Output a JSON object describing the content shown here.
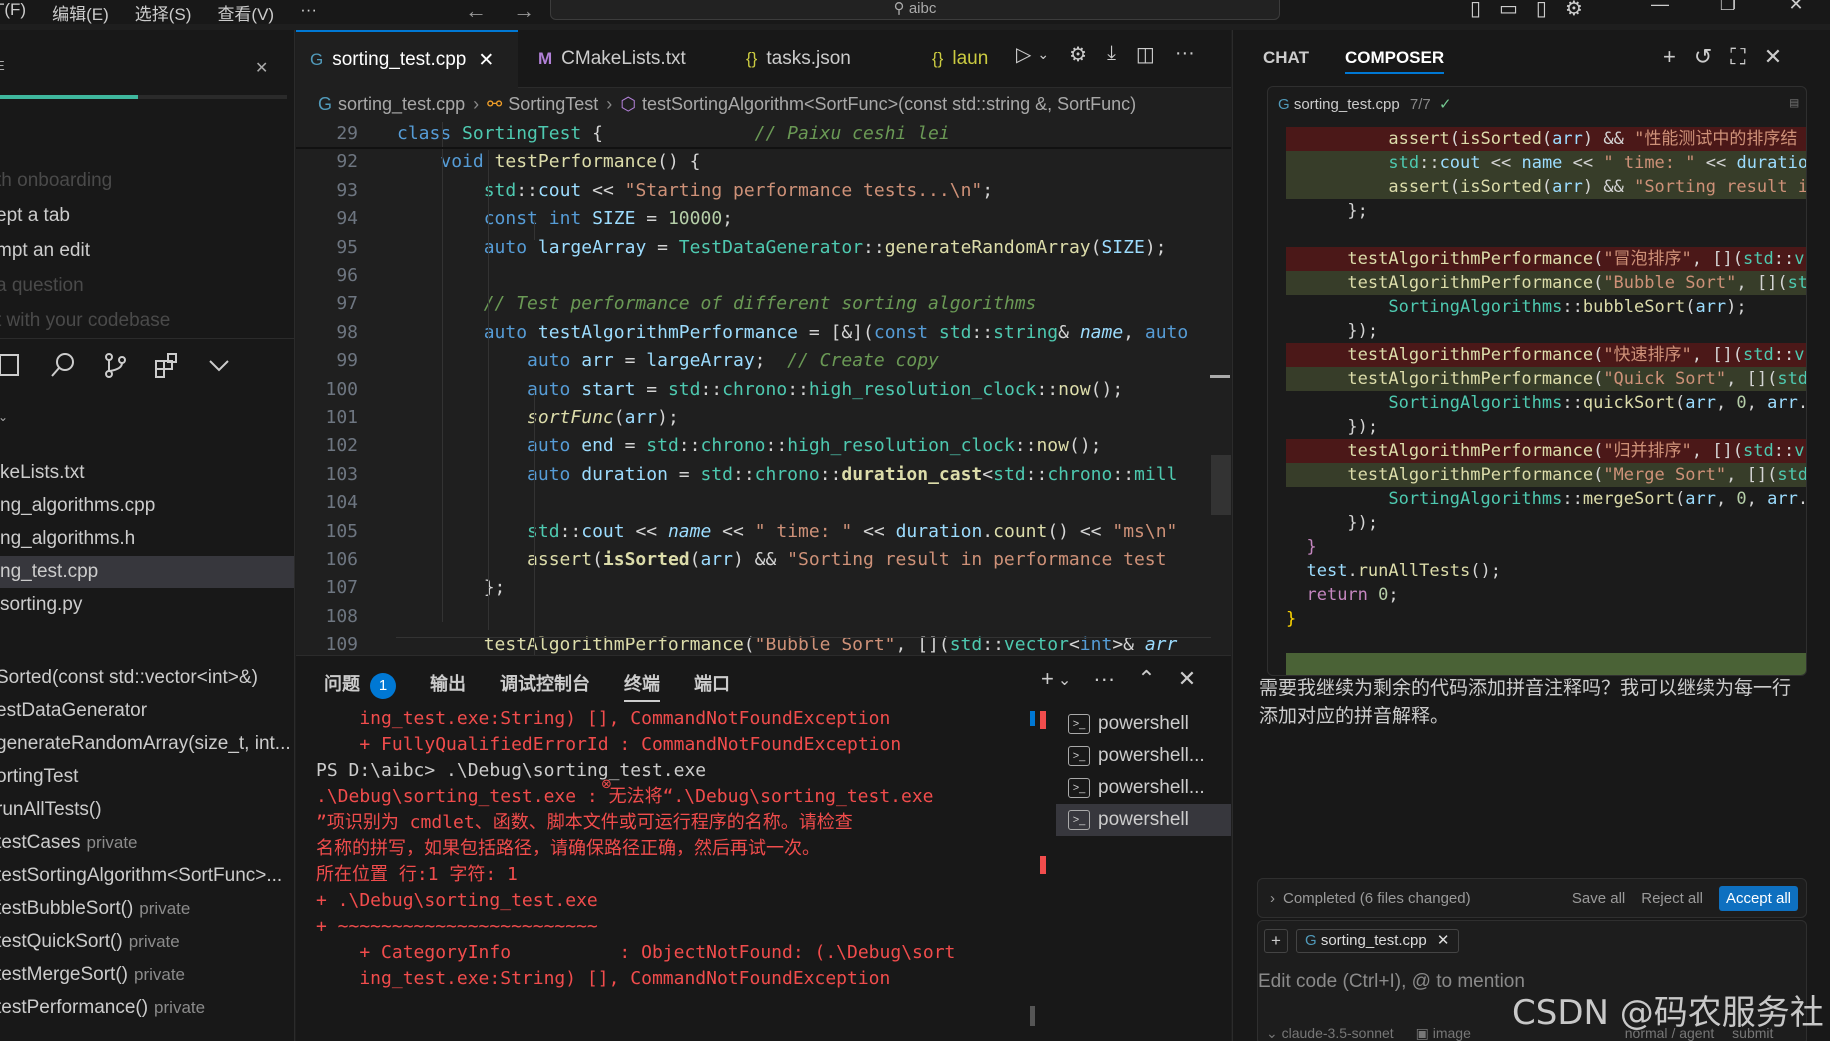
{
  "menu": [
    "T(F)",
    "编辑(E)",
    "选择(S)",
    "查看(V)",
    "···"
  ],
  "command_center": "aibc",
  "sidebar": {
    "onboarding": [
      {
        "label": "th onboarding",
        "dim": true
      },
      {
        "label": "ept a tab",
        "dim": false
      },
      {
        "label": "mpt an edit",
        "dim": false
      },
      {
        "label": "a question",
        "dim": true
      },
      {
        "label": "t with your codebase",
        "dim": true
      }
    ],
    "onboarding_progress": 0.48,
    "files": [
      "keLists.txt",
      "ng_algorithms.cpp",
      "ng_algorithms.h",
      "ng_test.cpp",
      "sorting.py"
    ],
    "selected_file": "ng_test.cpp",
    "outline": [
      {
        "name": "Sorted(const std::vector<int>&)",
        "vis": ""
      },
      {
        "name": "estDataGenerator",
        "vis": ""
      },
      {
        "name": "generateRandomArray(size_t, int...",
        "vis": ""
      },
      {
        "name": "ortingTest",
        "vis": ""
      },
      {
        "name": "runAllTests()",
        "vis": ""
      },
      {
        "name": "testCases",
        "vis": "private"
      },
      {
        "name": "testSortingAlgorithm<SortFunc>...",
        "vis": ""
      },
      {
        "name": "testBubbleSort()",
        "vis": "private"
      },
      {
        "name": "testQuickSort()",
        "vis": "private"
      },
      {
        "name": "testMergeSort()",
        "vis": "private"
      },
      {
        "name": "testPerformance()",
        "vis": "private"
      }
    ]
  },
  "tabs": [
    {
      "label": "sorting_test.cpp",
      "active": true,
      "icon": "C++"
    },
    {
      "label": "CMakeLists.txt",
      "active": false,
      "icon": "M"
    },
    {
      "label": "tasks.json",
      "active": false,
      "icon": "{}"
    },
    {
      "label": "laun",
      "active": false,
      "icon": "{}"
    }
  ],
  "breadcrumb": [
    "sorting_test.cpp",
    "SortingTest",
    "testSortingAlgorithm<SortFunc>(const std::string &, SortFunc)"
  ],
  "code_lines": [
    {
      "n": "29",
      "html": "<span class='k'>class</span> <span class='t'>SortingTest</span> {              <span class='c'>// Paixu ceshi lei</span>"
    },
    {
      "n": "92",
      "html": "    <span class='k'>void</span> <span class='f'>testPerformance</span>() {"
    },
    {
      "n": "93",
      "html": "        <span class='t'>std</span>::<span class='v'>cout</span> &lt;&lt; <span class='s'>\"Starting performance tests...\\n\"</span>;"
    },
    {
      "n": "94",
      "html": "        <span class='k'>const</span> <span class='k'>int</span> <span class='v'>SIZE</span> = <span class='n'>10000</span>;"
    },
    {
      "n": "95",
      "html": "        <span class='k'>auto</span> <span class='v'>largeArray</span> = <span class='t'>TestDataGenerator</span>::<span class='f'>generateRandomArray</span>(<span class='v'>SIZE</span>);"
    },
    {
      "n": "96",
      "html": ""
    },
    {
      "n": "97",
      "html": "        <span class='c'>// Test performance of different sorting algorithms</span>"
    },
    {
      "n": "98",
      "html": "        <span class='k'>auto</span> <span class='v'>testAlgorithmPerformance</span> = [&amp;](<span class='k'>const</span> <span class='t'>std</span>::<span class='t'>string</span>&amp; <span class='v'><i>name</i></span>, <span class='k'>auto</span>"
    },
    {
      "n": "99",
      "html": "            <span class='k'>auto</span> <span class='v'>arr</span> = <span class='v'>largeArray</span>;  <span class='c'>// Create copy</span>"
    },
    {
      "n": "100",
      "html": "            <span class='k'>auto</span> <span class='v'>start</span> = <span class='t'>std</span>::<span class='t'>chrono</span>::<span class='t'>high_resolution_clock</span>::<span class='f'>now</span>();"
    },
    {
      "n": "101",
      "html": "            <span class='f'><i>sortFunc</i></span>(<span class='v'>arr</span>);"
    },
    {
      "n": "102",
      "html": "            <span class='k'>auto</span> <span class='v'>end</span> = <span class='t'>std</span>::<span class='t'>chrono</span>::<span class='t'>high_resolution_clock</span>::<span class='f'>now</span>();"
    },
    {
      "n": "103",
      "html": "            <span class='k'>auto</span> <span class='v'>duration</span> = <span class='t'>std</span>::<span class='t'>chrono</span>::<b class='f'>duration_cast</b>&lt;<span class='t'>std</span>::<span class='t'>chrono</span>::<span class='t'>mill</span>"
    },
    {
      "n": "104",
      "html": ""
    },
    {
      "n": "105",
      "html": "            <span class='t'>std</span>::<span class='v'>cout</span> &lt;&lt; <span class='v'><i>name</i></span> &lt;&lt; <span class='s'>\" time: \"</span> &lt;&lt; <span class='v'>duration</span>.<span class='f'>count</span>() &lt;&lt; <span class='s'>\"ms\\n\"</span>"
    },
    {
      "n": "106",
      "html": "            <span class='f'>assert</span>(<b class='f'>isSorted</b>(<span class='v'>arr</span>) &amp;&amp; <span class='s'>\"Sorting result in performance test </span>"
    },
    {
      "n": "107",
      "html": "        };"
    },
    {
      "n": "108",
      "html": ""
    },
    {
      "n": "109",
      "html": "        <span class='f'>testAlgorithmPerformance</span>(<span class='s'>\"Bubble Sort\"</span>, [](<span class='t'>std</span>::<span class='t'>vector</span>&lt;<span class='k'>int</span>&gt;&amp; <span class='v'><i>arr</i></span>"
    }
  ],
  "panel": {
    "tabs": [
      "问题",
      "输出",
      "调试控制台",
      "终端",
      "端口"
    ],
    "active_tab": "终端",
    "problems_count": "1",
    "terminal_lines": [
      {
        "text": "    ing_test.exe:String) [], CommandNotFoundException",
        "white": false
      },
      {
        "text": "    + FullyQualifiedErrorId : CommandNotFoundException",
        "white": false
      },
      {
        "text": "",
        "white": false
      },
      {
        "text": "PS D:\\aibc> .\\Debug\\sorting_test.exe",
        "white": true
      },
      {
        "text": ".\\Debug\\sorting_test.exe : 无法将“.\\Debug\\sorting_test.exe",
        "white": false
      },
      {
        "text": "”项识别为 cmdlet、函数、脚本文件或可运行程序的名称。请检查",
        "white": false
      },
      {
        "text": "名称的拼写，如果包括路径，请确保路径正确，然后再试一次。",
        "white": false
      },
      {
        "text": "所在位置 行:1 字符: 1",
        "white": false
      },
      {
        "text": "+ .\\Debug\\sorting_test.exe",
        "white": false
      },
      {
        "text": "+ ~~~~~~~~~~~~~~~~~~~~~~~~",
        "white": false
      },
      {
        "text": "    + CategoryInfo          : ObjectNotFound: (.\\Debug\\sort",
        "white": false
      },
      {
        "text": "    ing_test.exe:String) [], CommandNotFoundException",
        "white": false
      }
    ],
    "terminals": [
      "powershell",
      "powershell...",
      "powershell...",
      "powershell"
    ],
    "selected_terminal_index": 3
  },
  "composer": {
    "tabs": [
      "CHAT",
      "COMPOSER"
    ],
    "active_tab": "COMPOSER",
    "diff_file": "sorting_test.cpp",
    "diff_count": "7/7",
    "diff_lines": [
      {
        "kind": "del",
        "html": "          <span class='f'>assert</span>(<span class='f'>isSorted</span>(<span class='v'>arr</span>) &amp;&amp; <span class='s'>\"性能测试中的排序结</span>"
      },
      {
        "kind": "add",
        "html": "          <span class='t'>std</span>::<span class='v'>cout</span> &lt;&lt; <span class='v'>name</span> &lt;&lt; <span class='s'>\" time: \"</span> &lt;&lt; <span class='v'>duration</span>"
      },
      {
        "kind": "add",
        "html": "          <span class='f'>assert</span>(<span class='f'>isSorted</span>(<span class='v'>arr</span>) &amp;&amp; <span class='s'>\"Sorting result in</span>"
      },
      {
        "kind": "",
        "html": "      };"
      },
      {
        "kind": "",
        "html": ""
      },
      {
        "kind": "del",
        "html": "      <span class='f'>testAlgorithmPerformance</span>(<span class='s'>\"冒泡排序\"</span>, [](<span class='t'>std</span>::<span class='t'>v</span>"
      },
      {
        "kind": "add",
        "html": "      <span class='f'>testAlgorithmPerformance</span>(<span class='s'>\"Bubble Sort\"</span>, [](<span class='t'>st</span>"
      },
      {
        "kind": "",
        "html": "          <span class='t'>SortingAlgorithms</span>::<span class='f'>bubbleSort</span>(<span class='v'>arr</span>);"
      },
      {
        "kind": "",
        "html": "      });"
      },
      {
        "kind": "del",
        "html": "      <span class='f'>testAlgorithmPerformance</span>(<span class='s'>\"快速排序\"</span>, [](<span class='t'>std</span>::<span class='t'>v</span>"
      },
      {
        "kind": "add",
        "html": "      <span class='f'>testAlgorithmPerformance</span>(<span class='s'>\"Quick Sort\"</span>, [](<span class='t'>std</span>"
      },
      {
        "kind": "",
        "html": "          <span class='t'>SortingAlgorithms</span>::<span class='f'>quickSort</span>(<span class='v'>arr</span>, <span class='n'>0</span>, <span class='v'>arr</span>.:"
      },
      {
        "kind": "",
        "html": "      });"
      },
      {
        "kind": "del",
        "html": "      <span class='f'>testAlgorithmPerformance</span>(<span class='s'>\"归并排序\"</span>, [](<span class='t'>std</span>::<span class='t'>v</span>"
      },
      {
        "kind": "add",
        "html": "      <span class='f'>testAlgorithmPerformance</span>(<span class='s'>\"Merge Sort\"</span>, [](<span class='t'>std</span>"
      },
      {
        "kind": "",
        "html": "          <span class='t'>SortingAlgorithms</span>::<span class='f'>mergeSort</span>(<span class='v'>arr</span>, <span class='n'>0</span>, <span class='v'>arr</span>.:"
      },
      {
        "kind": "",
        "html": "      });"
      },
      {
        "kind": "",
        "html": "  <span class='ctl'>}</span>"
      },
      {
        "kind": "",
        "html": "  <span class='v'>test</span>.<span class='f'>runAllTests</span>();"
      },
      {
        "kind": "",
        "html": "  <span class='ctl'>return</span> <span class='n'>0</span>;"
      },
      {
        "kind": "",
        "html": "<span class='b'>}</span>"
      }
    ],
    "message": "需要我继续为剩余的代码添加拼音注释吗？我可以继续为每一行添加对应的拼音解释。",
    "completed": "Completed (6 files changed)",
    "save_all": "Save all",
    "reject_all": "Reject all",
    "accept_all": "Accept all",
    "context_file": "sorting_test.cpp",
    "input_placeholder": "Edit code (Ctrl+I), @ to mention",
    "model": "claude-3.5-sonnet",
    "image_label": "image",
    "mode": "normal",
    "agent": "agent",
    "submit": "submit"
  },
  "watermark": "CSDN @码农服务社"
}
